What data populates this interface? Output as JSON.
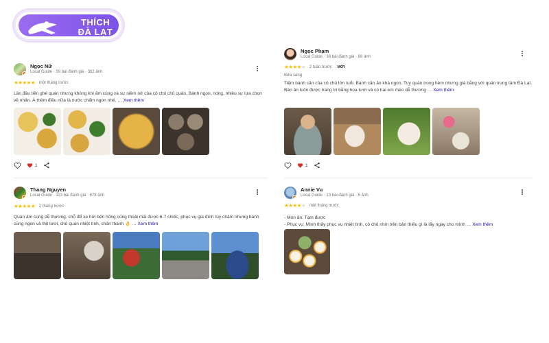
{
  "brand": {
    "line1": "THÍCH",
    "line2": "ĐÀ LẠT"
  },
  "reviews": [
    {
      "name": "Ngọc Nữ",
      "meta": "Local Guide · 59 bài đánh giá · 362 ảnh",
      "stars": 5,
      "stars_text": "★★★★★",
      "time": "một tháng trước",
      "text": "Lần đầu tiên ghé quán nhưng không khí ấm cúng và sự niềm nở của cô chủ chủ quán. Bánh ngon, nóng, nhiều sự lựa chọn về nhân. À thêm điều nữa là nước chấm ngon nhé. …",
      "see_more": "Xem thêm",
      "likes": "1"
    },
    {
      "name": "Ngọc Phạm",
      "meta": "Local Guide · 38 bài đánh giá · 88 ảnh",
      "stars": 4,
      "stars_on": "★★★★",
      "stars_off": "★",
      "time": "2 tuần trước",
      "new_tag": "MỚI",
      "sub_label": "Bữa sáng",
      "text": "Tiệm bánh căn của cô chủ lớn tuổi. Bánh căn ăn khá ngon. Tuy quán trong hẻm nhưng giá bằng với quán trung tâm Đà Lạt. Bàn ăn luôn được trang trí bằng hoa tươi và có hai em mèo dễ thương …",
      "see_more": "Xem thêm",
      "likes": "1"
    },
    {
      "name": "Thang Nguyen",
      "meta": "Local Guide · 113 bài đánh giá · 878 ảnh",
      "stars": 5,
      "stars_text": "★★★★★",
      "time": "2 tháng trước",
      "text": "Quán ấm cúng dễ thương, chỗ để xe hơi bên hông cũng thoải mái được 6-7 chiếc, phục vụ gia đình tuy chậm nhưng bánh cũng ngon và thịt tươi, chủ quán nhiệt tình, chân thành 👌 …",
      "see_more": "Xem thêm"
    },
    {
      "name": "Annie Vu",
      "meta": "Local Guide · 13 bài đánh giá · 5 ảnh",
      "stars": 4,
      "stars_on": "★★★★",
      "stars_off": "★",
      "time": "một tháng trước",
      "line1": "- Món ăn: Tạm được",
      "text": "- Phục vụ: Mình thấy phục vụ nhiệt tình, cô chủ nhìn trên bản thiếu gì là lấy ngay cho mình …",
      "see_more": "Xem thêm"
    }
  ],
  "colors": {
    "star": "#fbbc04",
    "link": "#1a0dab",
    "heart": "#d93025",
    "brand": "#8b5cf0"
  }
}
